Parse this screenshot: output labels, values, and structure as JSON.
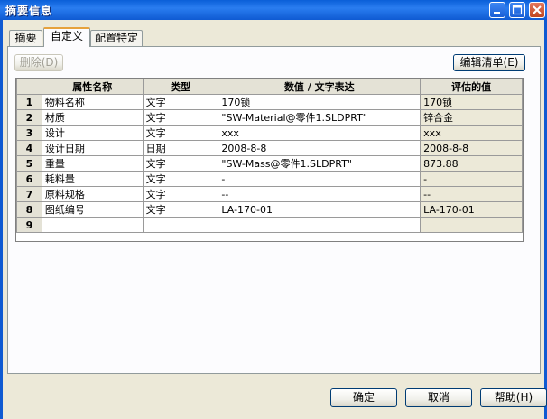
{
  "window": {
    "title": "摘要信息"
  },
  "tabs": [
    {
      "label": "摘要"
    },
    {
      "label": "自定义"
    },
    {
      "label": "配置特定"
    }
  ],
  "toolbar": {
    "delete_label": "删除(D)",
    "edit_list_label": "编辑清单(E)"
  },
  "table": {
    "columns": [
      "属性名称",
      "类型",
      "数值 / 文字表达",
      "评估的值"
    ],
    "rows": [
      {
        "num": "1",
        "name": "物料名称",
        "type": "文字",
        "value": "170锁",
        "evaluated": "170锁"
      },
      {
        "num": "2",
        "name": "材质",
        "type": "文字",
        "value": "\"SW-Material@零件1.SLDPRT\"",
        "evaluated": "锌合金"
      },
      {
        "num": "3",
        "name": "设计",
        "type": "文字",
        "value": "xxx",
        "evaluated": "xxx"
      },
      {
        "num": "4",
        "name": "设计日期",
        "type": "日期",
        "value": "2008-8-8",
        "evaluated": "2008-8-8"
      },
      {
        "num": "5",
        "name": "重量",
        "type": "文字",
        "value": "\"SW-Mass@零件1.SLDPRT\"",
        "evaluated": "873.88"
      },
      {
        "num": "6",
        "name": "耗料量",
        "type": "文字",
        "value": "-",
        "evaluated": "-"
      },
      {
        "num": "7",
        "name": "原料规格",
        "type": "文字",
        "value": "--",
        "evaluated": "--"
      },
      {
        "num": "8",
        "name": "图纸编号",
        "type": "文字",
        "value": "LA-170-01",
        "evaluated": "LA-170-01"
      },
      {
        "num": "9",
        "name": "",
        "type": "",
        "value": "",
        "evaluated": ""
      }
    ]
  },
  "footer": {
    "ok_label": "确定",
    "cancel_label": "取消",
    "help_label": "帮助(H)"
  },
  "colors": {
    "titlebar": "#0a5fd8",
    "dialog_bg": "#ece9d8",
    "active_tab_accent": "#e6a23c",
    "header_bg": "#e4e2d6"
  },
  "icons": {
    "minimize": "minimize-icon",
    "maximize": "maximize-icon",
    "close": "close-icon"
  }
}
